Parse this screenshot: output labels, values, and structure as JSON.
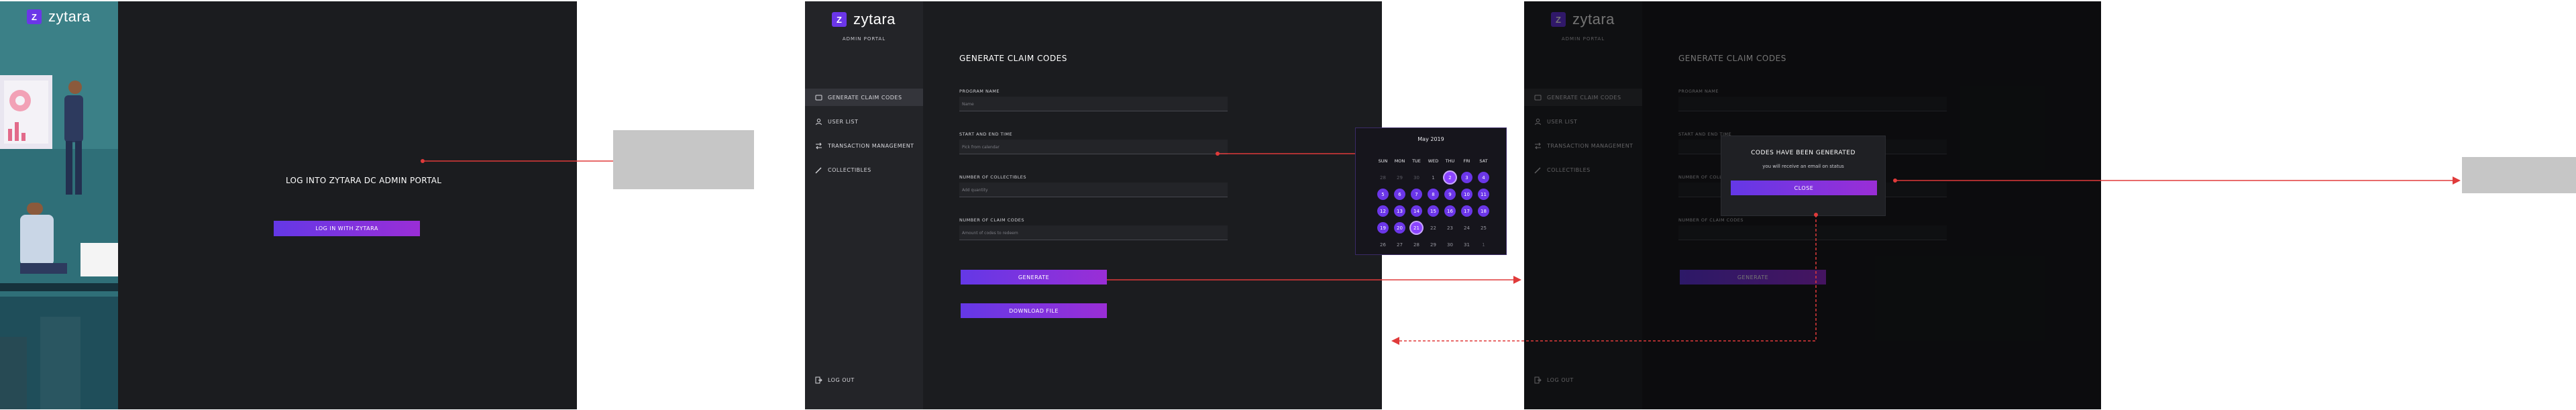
{
  "brand": {
    "logo_letter": "Z",
    "name": "zytara",
    "subtitle": "ADMIN PORTAL",
    "accent": "#6b36e8",
    "accent_end": "#9a2ed6"
  },
  "login": {
    "heading": "LOG INTO ZYTARA DC ADMIN PORTAL",
    "button_label": "LOG IN WITH ZYTARA"
  },
  "sidebar": {
    "items": [
      {
        "label": "GENERATE CLAIM CODES",
        "icon": "ticket-icon"
      },
      {
        "label": "USER LIST",
        "icon": "user-icon"
      },
      {
        "label": "TRANSACTION MANAGEMENT",
        "icon": "exchange-icon"
      },
      {
        "label": "COLLECTIBLES",
        "icon": "pen-icon"
      }
    ],
    "logout_label": "LOG OUT"
  },
  "form": {
    "title": "GENERATE CLAIM CODES",
    "fields": [
      {
        "label": "PROGRAM NAME",
        "placeholder": "Name"
      },
      {
        "label": "START AND END TIME",
        "placeholder": "Pick from calendar"
      },
      {
        "label": "NUMBER OF COLLECTIBLES",
        "placeholder": "Add quantity"
      },
      {
        "label": "NUMBER OF CLAIM CODES",
        "placeholder": "Amount of codes to redeem"
      }
    ],
    "generate_label": "GENERATE",
    "download_label": "DOWNLOAD FILE"
  },
  "calendar": {
    "month": "May 2019",
    "weekdays": [
      "SUN",
      "MON",
      "TUE",
      "WED",
      "THU",
      "FRI",
      "SAT"
    ],
    "days": [
      [
        "28",
        "29",
        "30",
        "1",
        "2",
        "3",
        "4"
      ],
      [
        "5",
        "6",
        "7",
        "8",
        "9",
        "10",
        "11"
      ],
      [
        "12",
        "13",
        "14",
        "15",
        "16",
        "17",
        "18"
      ],
      [
        "19",
        "20",
        "21",
        "22",
        "23",
        "24",
        "25"
      ],
      [
        "26",
        "27",
        "28",
        "29",
        "30",
        "31",
        "1"
      ]
    ],
    "selected_start": "2",
    "selected_end": "21"
  },
  "modal": {
    "title": "CODES HAVE BEEN GENERATED",
    "message": "you will receive an email on status",
    "close_label": "CLOSE"
  }
}
